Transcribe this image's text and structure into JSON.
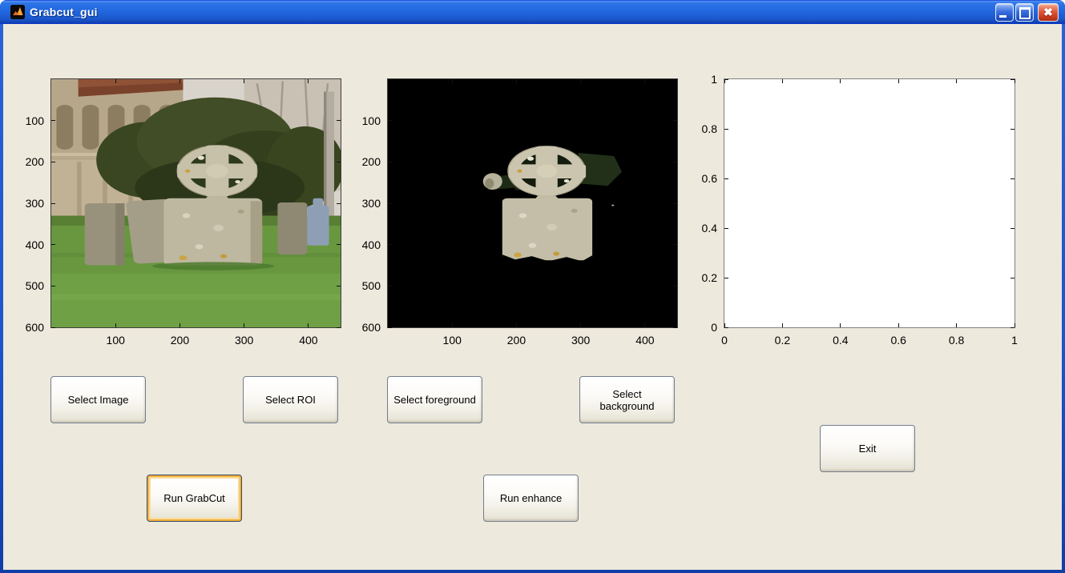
{
  "window": {
    "title": "Grabcut_gui",
    "app_icon": "matlab-logo-icon",
    "controls": {
      "minimize_icon": "minimize-icon",
      "maximize_icon": "maximize-icon",
      "close_icon": "close-icon"
    }
  },
  "colors": {
    "titlebar_blue": "#2268E0",
    "window_border_blue": "#0831D9",
    "client_background": "#EDE9DC",
    "button_border": "#747C90",
    "focus_ring_orange": "#F2B138",
    "segmented_background": "#000000",
    "close_button_red": "#D8482C"
  },
  "axes": {
    "original": {
      "description": "churchyard photo with celtic cross headstone",
      "x_max": 450,
      "y_max": 600,
      "y_direction": "down",
      "x_ticks": [
        100,
        200,
        300,
        400
      ],
      "y_ticks": [
        100,
        200,
        300,
        400,
        500,
        600
      ]
    },
    "segmented": {
      "description": "grabcut result: headstone on black background",
      "x_max": 450,
      "y_max": 600,
      "y_direction": "down",
      "x_ticks": [
        100,
        200,
        300,
        400
      ],
      "y_ticks": [
        100,
        200,
        300,
        400,
        500,
        600
      ]
    },
    "placeholder": {
      "description": "empty axes",
      "x_max": 1,
      "y_max": 1,
      "y_direction": "up",
      "x_ticks": [
        0,
        0.2,
        0.4,
        0.6,
        0.8,
        1
      ],
      "y_ticks": [
        0,
        0.2,
        0.4,
        0.6,
        0.8,
        1
      ]
    }
  },
  "buttons": {
    "select_image": "Select Image",
    "select_roi": "Select ROI",
    "select_foreground": "Select foreground",
    "select_background": "Select background",
    "exit": "Exit",
    "run_grabcut": "Run GrabCut",
    "run_enhance": "Run enhance"
  }
}
